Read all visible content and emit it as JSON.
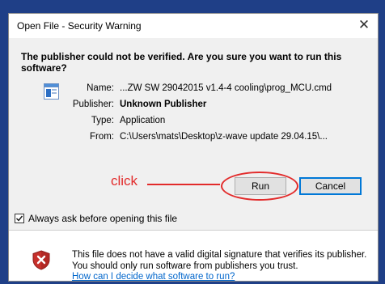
{
  "window": {
    "title": "Open File - Security Warning",
    "close_glyph": "✕"
  },
  "heading": "The publisher could not be verified.  Are you sure you want to run this software?",
  "info": {
    "name_label": "Name:",
    "name_value": "...ZW SW 29042015 v1.4-4 cooling\\prog_MCU.cmd",
    "publisher_label": "Publisher:",
    "publisher_value": "Unknown Publisher",
    "type_label": "Type:",
    "type_value": "Application",
    "from_label": "From:",
    "from_value": "C:\\Users\\mats\\Desktop\\z-wave update 29.04.15\\..."
  },
  "annotation": {
    "text": "click",
    "color": "#e22b2b"
  },
  "buttons": {
    "run_label": "Run",
    "cancel_label": "Cancel"
  },
  "checkbox": {
    "label": "Always ask before opening this file",
    "checked": true
  },
  "footer": {
    "warning_text": "This file does not have a valid digital signature that verifies its publisher.  You should only run software from publishers you trust.",
    "link_text": "How can I decide what software to run?"
  },
  "icons": {
    "file": "file-icon",
    "shield": "shield-warning-icon",
    "close": "close-icon",
    "check": "checkmark-icon"
  },
  "colors": {
    "desktop": "#1f3f87",
    "link": "#0066cc",
    "focus": "#0078d7"
  }
}
